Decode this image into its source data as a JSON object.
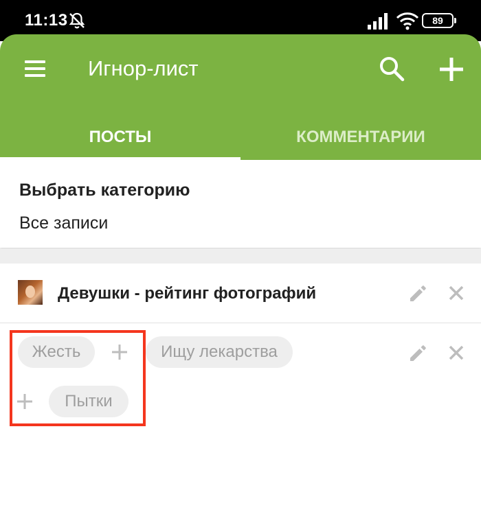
{
  "status_bar": {
    "time": "11:13",
    "battery": "89",
    "icons": [
      "mute-icon",
      "signal-icon",
      "wifi-icon",
      "battery-icon"
    ]
  },
  "app_bar": {
    "title": "Игнор-лист",
    "background_color": "#7cb342",
    "icons": [
      "menu-icon",
      "search-icon",
      "add-icon"
    ]
  },
  "tabs": [
    {
      "label": "ПОСТЫ",
      "active": true
    },
    {
      "label": "КОММЕНТАРИИ",
      "active": false
    }
  ],
  "category": {
    "label": "Выбрать категорию",
    "value": "Все записи"
  },
  "ignore_list": {
    "community": {
      "name": "Девушки - рейтинг фотографий",
      "icons": [
        "avatar",
        "edit-icon",
        "close-icon"
      ]
    },
    "tags": {
      "items": [
        "Жесть",
        "Ищу лекарства",
        "Пытки"
      ],
      "icons": [
        "plus-icon",
        "plus-icon",
        "edit-icon",
        "close-icon"
      ]
    }
  },
  "highlight_color": "#f4361e"
}
